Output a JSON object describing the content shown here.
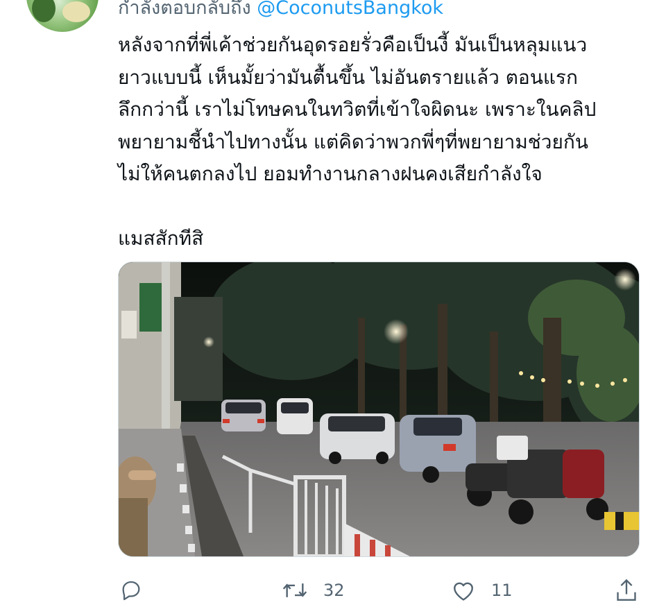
{
  "tweet": {
    "reply_prefix": "กำลังตอบกลับถึง",
    "reply_handle": "@CoconutsBangkok",
    "text_lines": [
      "หลังจากที่พี่เค้าช่วยกันอุดรอยรั่วคือเป็นงี้ มันเป็นหลุมแนว",
      "ยาวแบบนี้ เห็นมั้ยว่ามันตื้นขึ้น ไม่อันตรายแล้ว ตอนแรก",
      "ลึกกว่านี้ เราไม่โทษคนในทวิตที่เข้าใจผิดนะ เพราะในคลิป",
      "พยายามชี้นำไปทางนั้น แต่คิดว่าพวกพี่ๆที่พยายามช่วยกัน",
      "ไม่ให้คนตกลงไป ยอมทำงานกลางฝนคงเสียกำลังใจ"
    ],
    "text_last_line": "แมสสักทีสิ"
  },
  "actions": {
    "reply": {
      "icon": "reply-icon",
      "count": ""
    },
    "retweet": {
      "icon": "retweet-icon",
      "count": "32"
    },
    "like": {
      "icon": "heart-icon",
      "count": "11"
    },
    "share": {
      "icon": "share-icon",
      "count": ""
    }
  },
  "colors": {
    "text": "#0f1419",
    "secondary": "#536471",
    "link": "#1d9bf0",
    "border": "#cfd9de"
  }
}
